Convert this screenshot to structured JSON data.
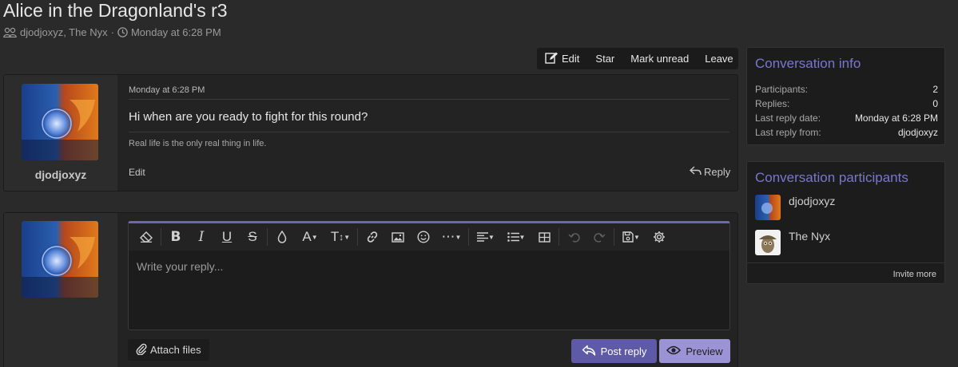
{
  "page": {
    "title": "Alice in the Dragonland's r3",
    "participants_text": "djodjoxyz, The Nyx",
    "separator": "·",
    "date_text": "Monday at 6:28 PM"
  },
  "toolbar": {
    "edit_label": "Edit",
    "star_label": "Star",
    "mark_unread_label": "Mark unread",
    "leave_label": "Leave"
  },
  "message": {
    "username": "djodjoxyz",
    "date": "Monday at 6:28 PM",
    "body": "Hi when are you ready to fight for this round?",
    "signature": "Real life is the only real thing in life.",
    "edit_label": "Edit",
    "reply_label": "Reply"
  },
  "reply_form": {
    "placeholder": "Write your reply...",
    "attach_label": "Attach files",
    "post_label": "Post reply",
    "preview_label": "Preview"
  },
  "editor_toolbar": {
    "icons": [
      "eraser-icon",
      "bold-icon",
      "italic-icon",
      "underline-icon",
      "strikethrough-icon",
      "color-drop-icon",
      "font-family-icon",
      "font-size-icon",
      "link-icon",
      "image-icon",
      "smiley-icon",
      "more-options-icon",
      "align-icon",
      "list-icon",
      "table-icon",
      "undo-icon",
      "redo-icon",
      "drafts-icon",
      "settings-icon"
    ]
  },
  "conversation_info": {
    "heading": "Conversation info",
    "rows": [
      {
        "label": "Participants:",
        "value": "2"
      },
      {
        "label": "Replies:",
        "value": "0"
      },
      {
        "label": "Last reply date:",
        "value": "Monday at 6:28 PM"
      },
      {
        "label": "Last reply from:",
        "value": "djodjoxyz"
      }
    ]
  },
  "participants": {
    "heading": "Conversation participants",
    "items": [
      {
        "name": "djodjoxyz"
      },
      {
        "name": "The Nyx"
      }
    ],
    "invite_label": "Invite more"
  },
  "colors": {
    "accent": "#7d74d0",
    "post_button": "#5f5aa8",
    "preview_button": "#9c93d6",
    "background": "#2a2a2a"
  }
}
